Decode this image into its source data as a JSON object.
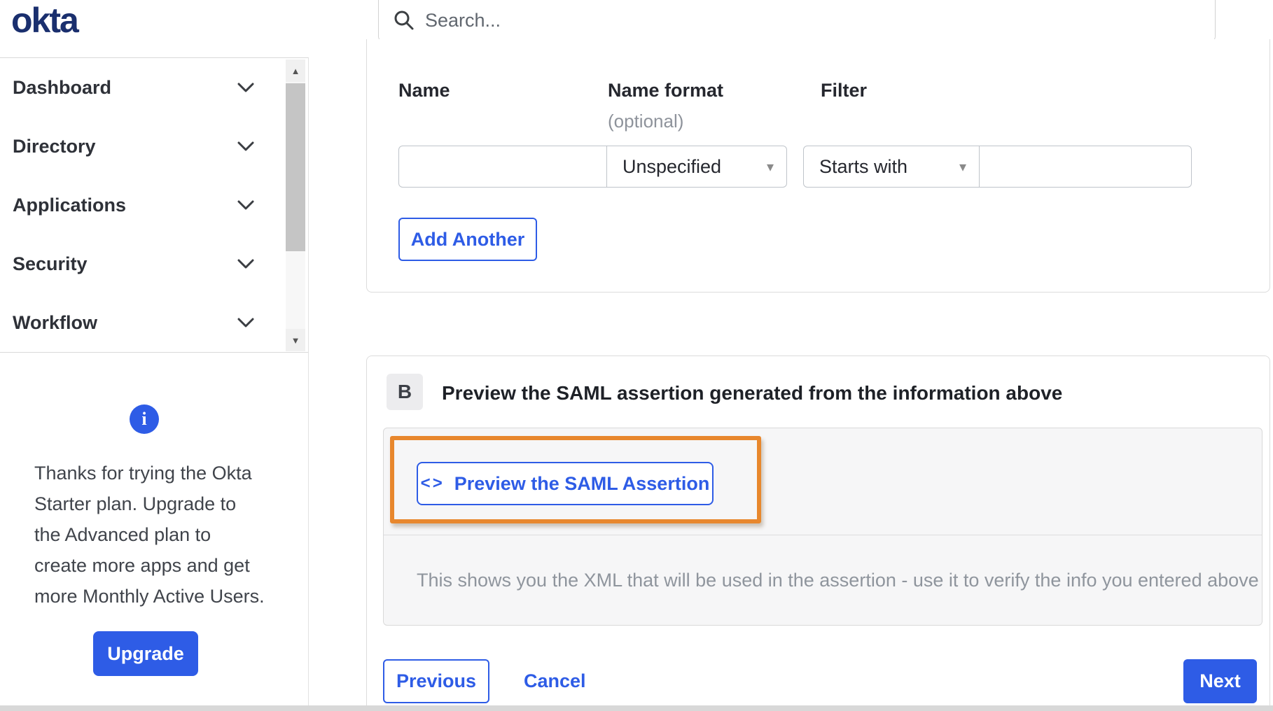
{
  "colors": {
    "accent_blue": "#2e5ce6",
    "logo_navy": "#1a2f6e",
    "highlight_orange": "#e8872d",
    "panel_gray": "#f6f6f7"
  },
  "icons": {
    "info": "i",
    "dropdown_arrow": "▾",
    "scroll_up": "▲",
    "scroll_down": "▼",
    "code": "<>"
  },
  "header": {
    "logo_text": "okta",
    "search_placeholder": "Search..."
  },
  "sidebar": {
    "items": [
      {
        "label": "Dashboard"
      },
      {
        "label": "Directory"
      },
      {
        "label": "Applications"
      },
      {
        "label": "Security"
      },
      {
        "label": "Workflow"
      }
    ],
    "upgrade_panel": {
      "message": "Thanks for trying the Okta Starter plan. Upgrade to the Advanced plan to create more apps and get more Monthly Active Users.",
      "upgrade_label": "Upgrade"
    }
  },
  "attribute_form": {
    "name_label": "Name",
    "name_format_label": "Name format",
    "name_format_sublabel": "(optional)",
    "filter_label": "Filter",
    "name_value": "",
    "name_format_selected": "Unspecified",
    "filter_type_selected": "Starts with",
    "filter_value": "",
    "add_another_label": "Add Another"
  },
  "preview_section": {
    "step_badge": "B",
    "heading": "Preview the SAML assertion generated from the information above",
    "preview_button_label": "Preview the SAML Assertion",
    "description": "This shows you the XML that will be used in the assertion - use it to verify the info you entered above"
  },
  "wizard_footer": {
    "previous_label": "Previous",
    "cancel_label": "Cancel",
    "next_label": "Next"
  }
}
